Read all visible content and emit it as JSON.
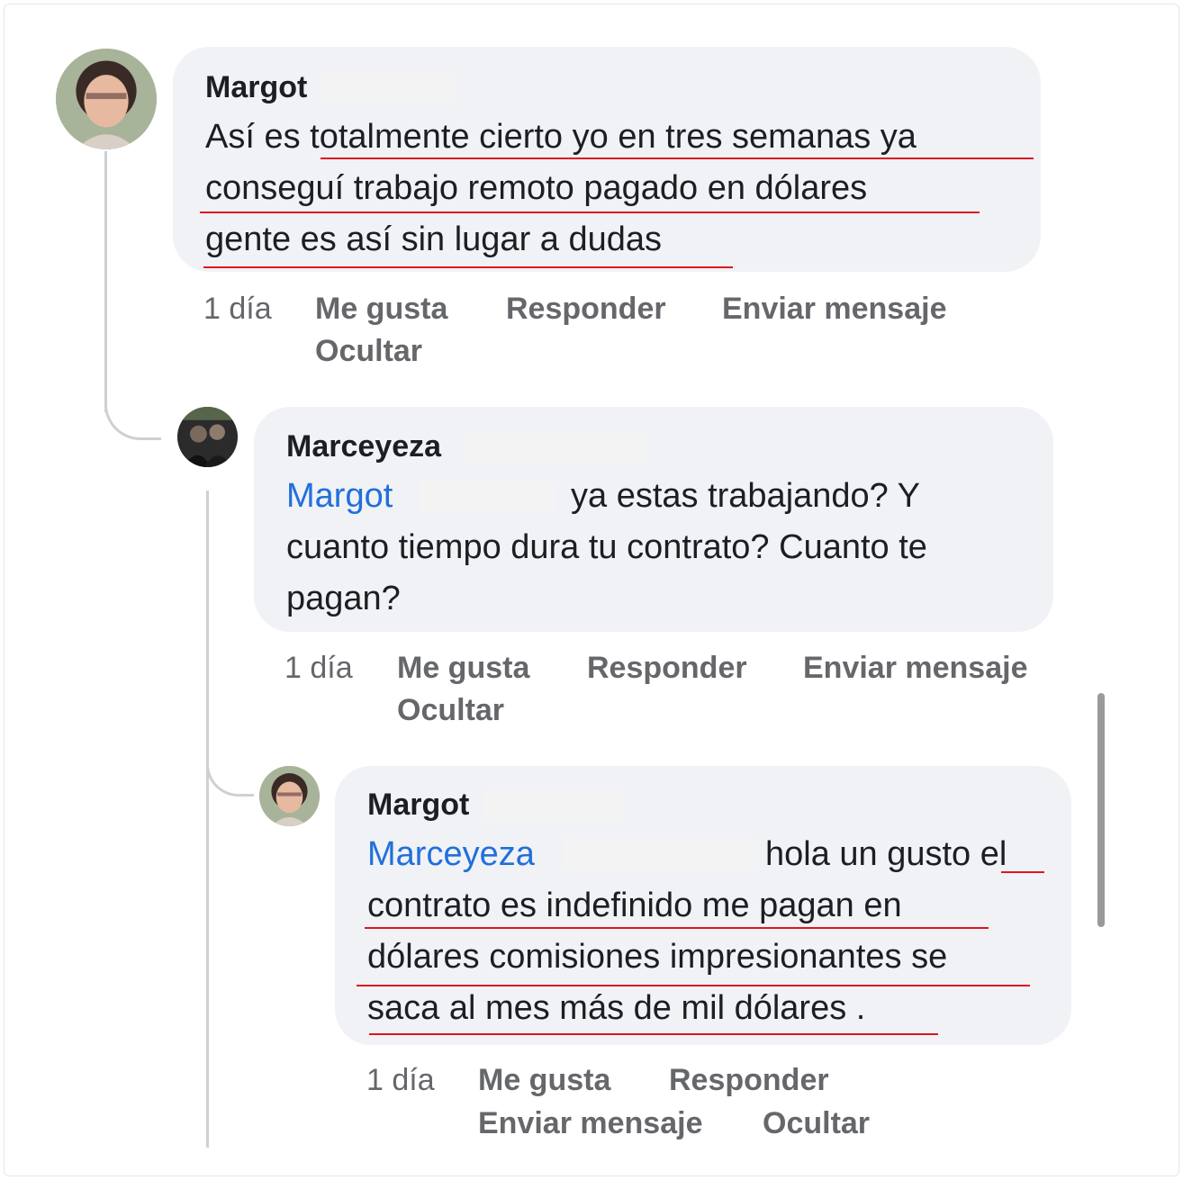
{
  "comments": [
    {
      "author": "Margot",
      "lines": [
        "Así es totalmente cierto yo en tres semanas ya",
        "conseguí trabajo remoto pagado en dólares",
        "gente es así sin lugar a dudas"
      ],
      "time": "1 día",
      "like": "Me gusta",
      "reply": "Responder",
      "message": "Enviar mensaje",
      "hide": "Ocultar"
    },
    {
      "author": "Marceyeza",
      "mention": "Margot",
      "lines": [
        "ya estas trabajando? Y",
        "cuanto tiempo dura tu contrato? Cuanto te",
        "pagan?"
      ],
      "time": "1 día",
      "like": "Me gusta",
      "reply": "Responder",
      "message": "Enviar mensaje",
      "hide": "Ocultar"
    },
    {
      "author": "Margot",
      "mention": "Marceyeza",
      "lines": [
        "hola un gusto el",
        "contrato es indefinido me pagan en",
        "dólares comisiones impresionantes se",
        "saca al mes más de mil dólares ."
      ],
      "time": "1 día",
      "like": "Me gusta",
      "reply": "Responder",
      "message": "Enviar mensaje",
      "hide": "Ocultar"
    }
  ],
  "colors": {
    "bubble": "#f0f2f5",
    "mention": "#216fdb",
    "underline": "#e0141e",
    "meta": "#65676b"
  }
}
